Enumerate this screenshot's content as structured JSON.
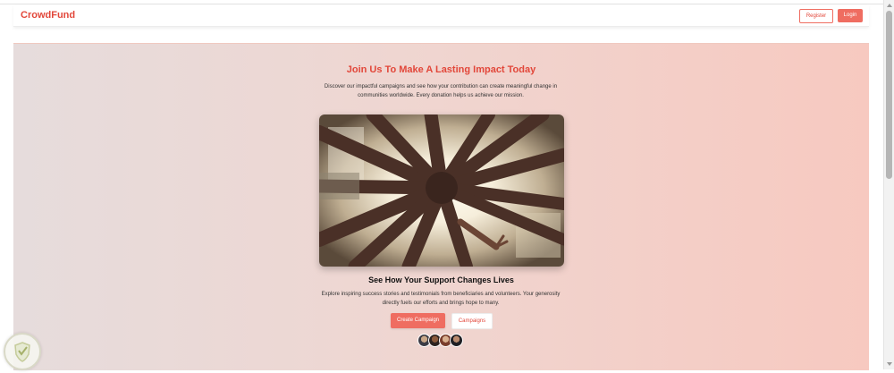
{
  "navbar": {
    "brand": "CrowdFund",
    "register_label": "Register",
    "login_label": "Login"
  },
  "hero": {
    "title": "Join Us To Make A Lasting Impact Today",
    "description": "Discover our impactful campaigns and see how your contribution can create meaningful change in communities worldwide. Every donation helps us achieve our mission.",
    "image_icon": "hands-together-photo",
    "subtitle": "See How Your Support Changes Lives",
    "subdescription": "Explore inspiring success stories and testimonials from beneficiaries and volunteers. Your generosity directly fuels our efforts and brings hope to many.",
    "create_campaign_label": "Create Campaign",
    "campaigns_label": "Campaigns"
  },
  "avatars": [
    "avatar-1",
    "avatar-2",
    "avatar-3",
    "avatar-4"
  ],
  "colors": {
    "accent": "#ef6d61",
    "brand": "#e2473a",
    "gradient_start": "#e6dcdc",
    "gradient_end": "#f7c9c0"
  }
}
